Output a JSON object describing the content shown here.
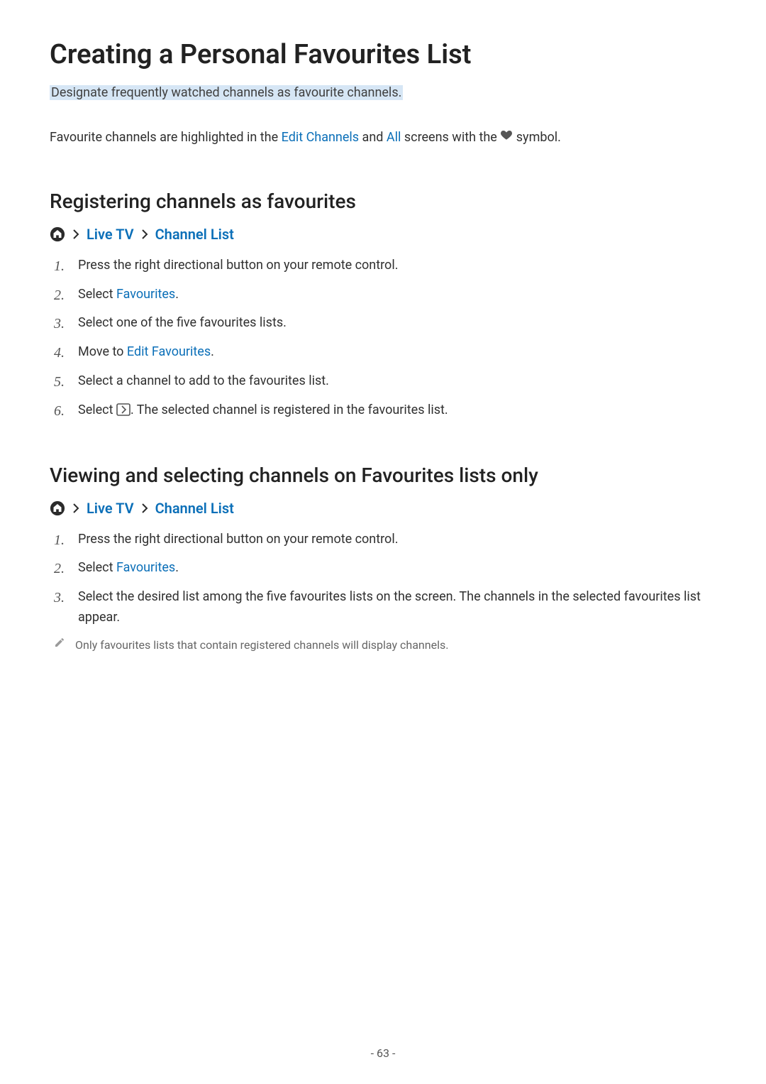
{
  "title": "Creating a Personal Favourites List",
  "subtitle": "Designate frequently watched channels as favourite channels.",
  "intro": {
    "pre": "Favourite channels are highlighted in the ",
    "link1": "Edit Channels",
    "mid1": " and ",
    "link2": "All",
    "mid2": " screens with the ",
    "post": " symbol."
  },
  "section1": {
    "heading": "Registering channels as favourites",
    "crumb": {
      "a": "Live TV",
      "b": "Channel List"
    },
    "steps": {
      "s1": "Press the right directional button on your remote control.",
      "s2_pre": "Select ",
      "s2_link": "Favourites",
      "s2_post": ".",
      "s3": "Select one of the five favourites lists.",
      "s4_pre": "Move to ",
      "s4_link": "Edit Favourites",
      "s4_post": ".",
      "s5": "Select a channel to add to the favourites list.",
      "s6_pre": "Select ",
      "s6_post": ". The selected channel is registered in the favourites list."
    }
  },
  "section2": {
    "heading": "Viewing and selecting channels on Favourites lists only",
    "crumb": {
      "a": "Live TV",
      "b": "Channel List"
    },
    "steps": {
      "s1": "Press the right directional button on your remote control.",
      "s2_pre": "Select ",
      "s2_link": "Favourites",
      "s2_post": ".",
      "s3": "Select the desired list among the five favourites lists on the screen. The channels in the selected favourites list appear."
    },
    "note": "Only favourites lists that contain registered channels will display channels."
  },
  "pageNumber": "- 63 -"
}
